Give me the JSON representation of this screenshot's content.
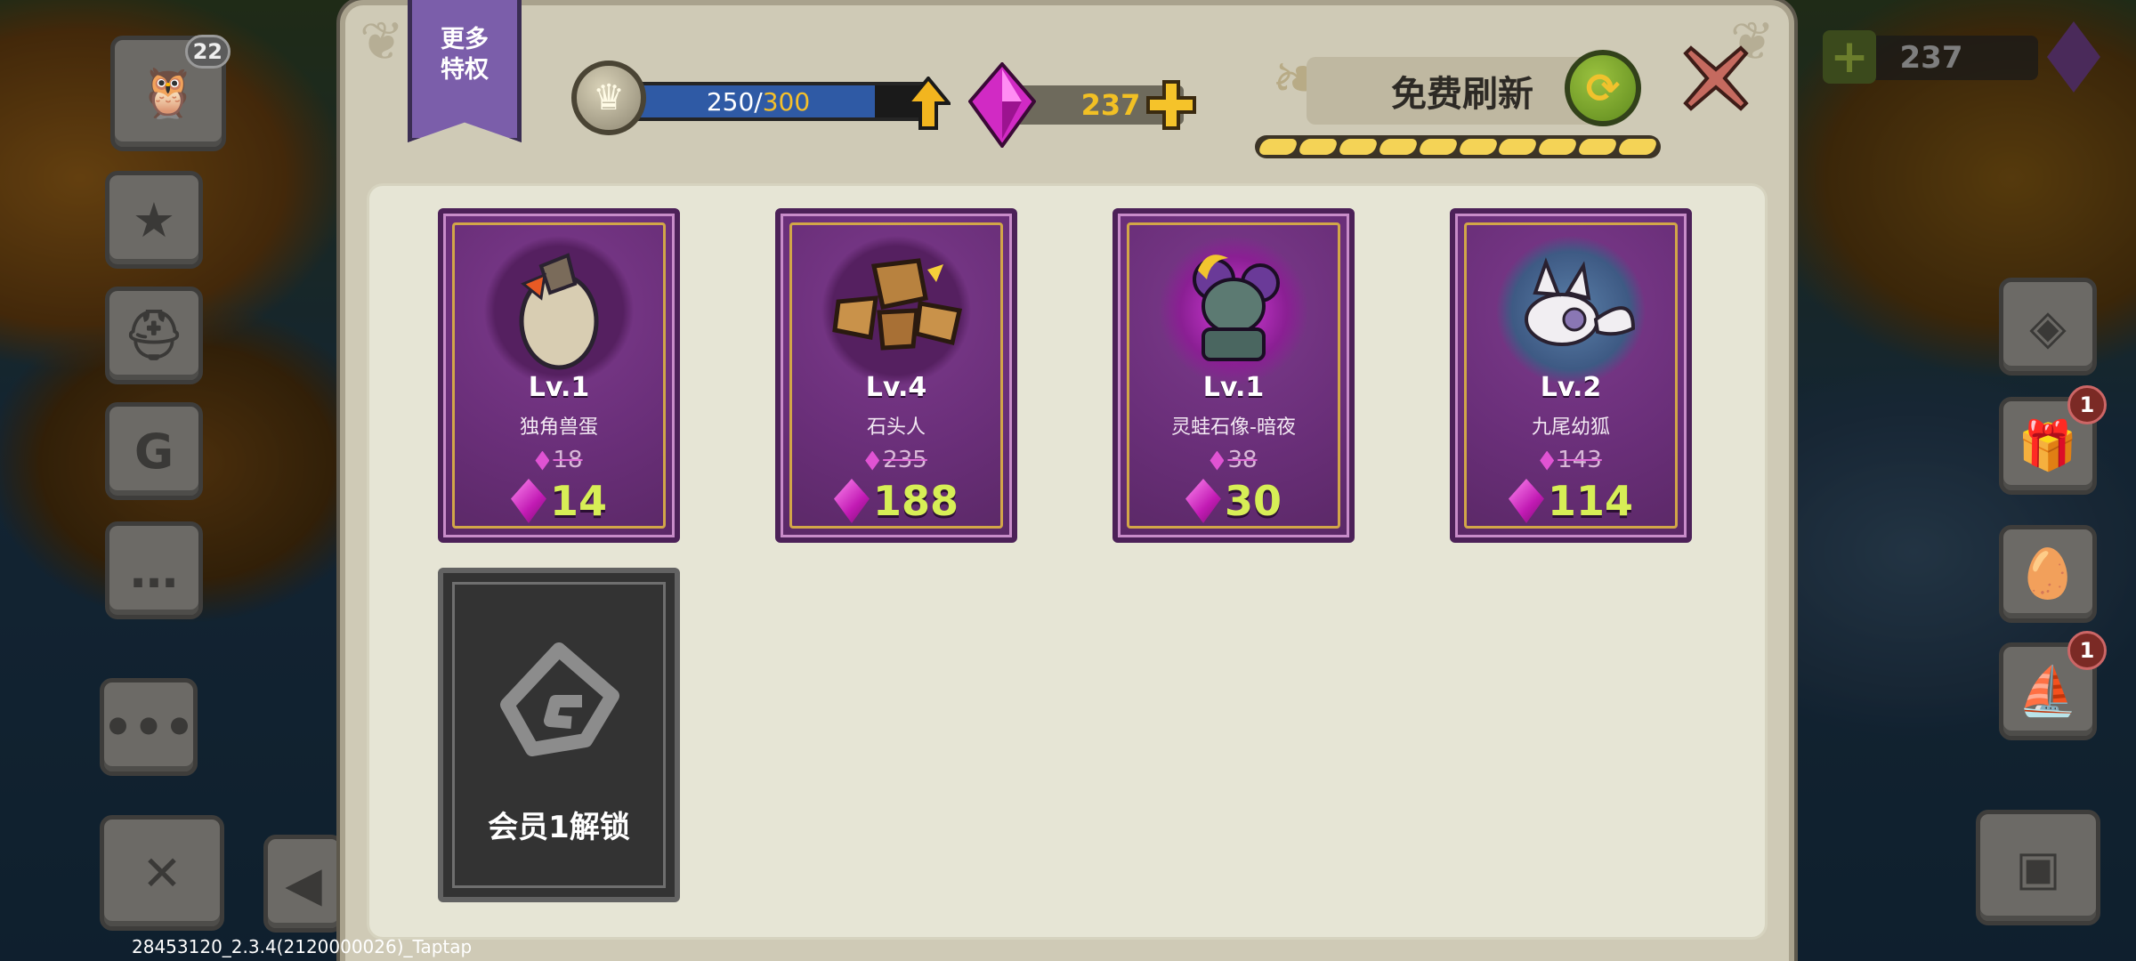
{
  "background": {
    "avatar_level": "22",
    "gem_count": "237",
    "badges": [
      "1",
      "1"
    ]
  },
  "panel": {
    "ribbon_label_line1": "更多",
    "ribbon_label_line2": "特权",
    "xp": {
      "current": "250",
      "separator": "/",
      "max": "300",
      "fraction": 0.83
    },
    "gems": "237",
    "refresh_label": "免费刷新",
    "refresh_segments": 10
  },
  "cards": [
    {
      "level": "Lv.1",
      "name": "独角兽蛋",
      "old_price": "18",
      "price": "14",
      "art": "egg-icon"
    },
    {
      "level": "Lv.4",
      "name": "石头人",
      "old_price": "235",
      "price": "188",
      "art": "rock-golem-icon"
    },
    {
      "level": "Lv.1",
      "name": "灵蛙石像-暗夜",
      "old_price": "38",
      "price": "30",
      "art": "frog-statue-icon"
    },
    {
      "level": "Lv.2",
      "name": "九尾幼狐",
      "old_price": "143",
      "price": "114",
      "art": "fox-icon"
    }
  ],
  "locked_slot": {
    "label": "会员1解锁"
  },
  "watermark": "28453120_2.3.4(2120000026)_Taptap",
  "colors": {
    "card_purple": "#6a2f79",
    "price_green": "#d7ee56",
    "gem_pink": "#e053d3",
    "gold": "#f2c024"
  }
}
